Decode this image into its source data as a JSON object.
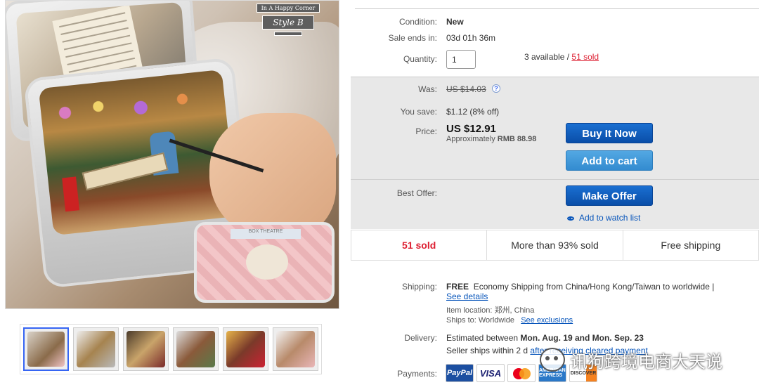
{
  "product": {
    "condition_label": "Condition:",
    "condition_value": "New",
    "sale_ends_label": "Sale ends in:",
    "sale_ends_value": "03d 01h 36m",
    "quantity_label": "Quantity:",
    "quantity_value": "1",
    "available_text": "3 available / ",
    "sold_link": "51 sold"
  },
  "image": {
    "badge_line1": "In A Happy Corner",
    "badge_style": "Style B",
    "box_label": "BOX THEATRE"
  },
  "pricing": {
    "was_label": "Was:",
    "was_value": "US $14.03",
    "help_icon": "?",
    "save_label": "You save:",
    "save_value": "$1.12 (8% off)",
    "price_label": "Price:",
    "price_value": "US $12.91",
    "approx_prefix": "Approximately",
    "approx_value": "RMB 88.98",
    "buy_now": "Buy It Now",
    "add_to_cart": "Add to cart",
    "best_offer_label": "Best Offer:",
    "make_offer": "Make Offer",
    "watch_list": "Add to watch list"
  },
  "stats": {
    "sold": "51 sold",
    "percent": "More than 93% sold",
    "shipping": "Free shipping"
  },
  "shipping": {
    "label": "Shipping:",
    "free": "FREE",
    "desc": "Economy Shipping from China/Hong Kong/Taiwan to worldwide |",
    "see_details": "See details",
    "item_location": "Item location:  郑州, China",
    "ships_to_prefix": "Ships to:  Worldwide",
    "see_exclusions": "See exclusions"
  },
  "delivery": {
    "label": "Delivery:",
    "estimated_prefix": "Estimated between",
    "estimated_dates": "Mon. Aug. 19 and Mon. Sep. 23",
    "seller_ships": "Seller ships within 2 d",
    "after_link": "after receiving cleared payment"
  },
  "payments": {
    "label": "Payments:",
    "paypal": "PayPal",
    "visa": "VISA",
    "amex": "AMERICAN EXPRESS",
    "discover": "DISCOVER"
  },
  "watermark": {
    "text": "讯狗跨境电商大天说"
  }
}
